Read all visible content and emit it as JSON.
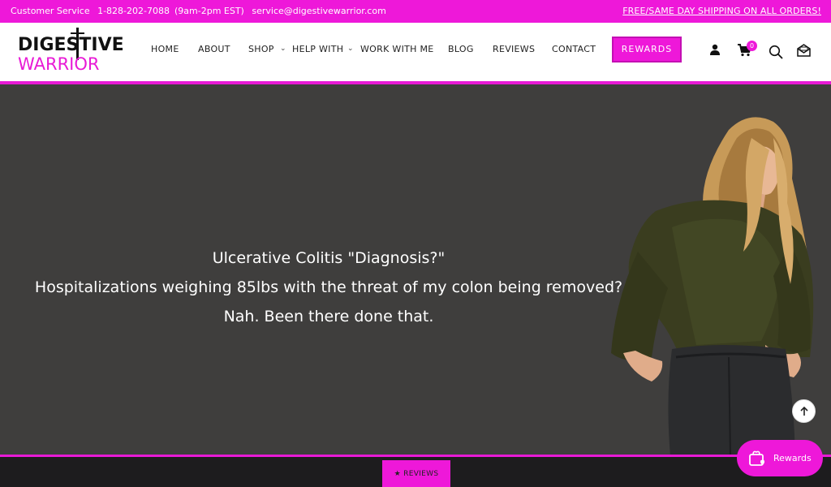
{
  "topbar": {
    "customer_service": "Customer Service",
    "phone": "1-828-202-7088",
    "hours": "(9am-2pm EST)",
    "email": "service@digestivewarrior.com",
    "shipping": "FREE/SAME DAY SHIPPING ON ALL ORDERS!"
  },
  "logo": {
    "line1": "DIGESTIVE",
    "line2": "WARRIOR"
  },
  "nav": {
    "home": "HOME",
    "about": "ABOUT",
    "shop": "SHOP",
    "help_with": "HELP WITH",
    "work_with_me": "WORK WITH ME",
    "blog": "BLOG",
    "reviews": "REVIEWS",
    "contact": "CONTACT",
    "rewards": "REWARDS"
  },
  "cart": {
    "count": "0"
  },
  "hero": {
    "line1": "Ulcerative Colitis \"Diagnosis?\"",
    "line2": "Hospitalizations weighing 85lbs with the threat of my colon being removed?",
    "line3": "Nah. Been there done that."
  },
  "footer": {
    "reviews_tab": "★ REVIEWS"
  },
  "rewards_widget": {
    "label": "Rewards"
  },
  "colors": {
    "accent": "#ee18d9",
    "hero_bg": "#3f3e3d"
  }
}
